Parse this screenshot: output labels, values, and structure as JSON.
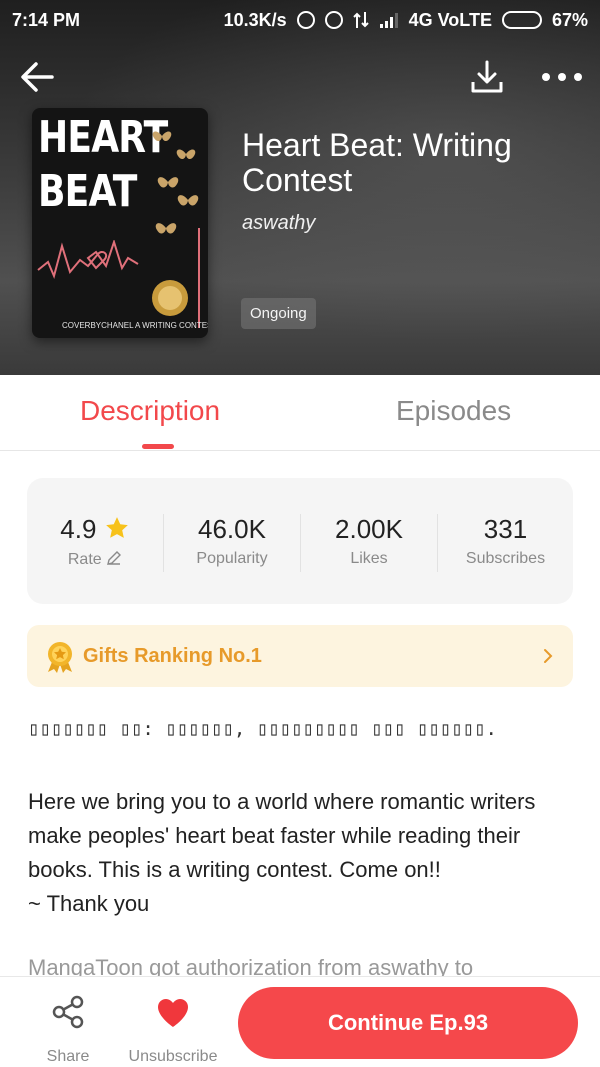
{
  "status_bar": {
    "time": "7:14 PM",
    "network_speed": "10.3K/s",
    "network": "4G VoLTE",
    "battery": "67%",
    "battery_level": 0.67
  },
  "topbar": {
    "back_icon": "arrow-left-icon",
    "download_icon": "download-icon",
    "more_icon": "more-dots-icon"
  },
  "book": {
    "cover": {
      "title_line1": "HEART",
      "title_line2": "BEAT",
      "footer": "COVERBYCHANEL  A WRITING CONTEST"
    },
    "title": "Heart Beat: Writing Contest",
    "author": "aswathy",
    "status": "Ongoing"
  },
  "tabs": [
    {
      "label": "Description",
      "active": true
    },
    {
      "label": "Episodes",
      "active": false
    }
  ],
  "stats": [
    {
      "value": "4.9",
      "label": "Rate"
    },
    {
      "value": "46.0K",
      "label": "Popularity"
    },
    {
      "value": "2.00K",
      "label": "Likes"
    },
    {
      "value": "331",
      "label": "Subscribes"
    }
  ],
  "gifts_ranking": {
    "label": "Gifts Ranking No.1"
  },
  "description": {
    "unsupported_line": "▯▯▯▯▯▯▯ ▯▯: ▯▯▯▯▯▯, ▯▯▯▯▯▯▯▯▯ ▯▯▯ ▯▯▯▯▯▯.",
    "body": "Here we bring you to a world where romantic writers make peoples' heart beat faster while reading their books. This is a writing contest. Come on!!",
    "sign_off": "~ Thank you",
    "faded_line": "MangaToon got authorization from aswathy to"
  },
  "bottom_bar": {
    "share_label": "Share",
    "unsubscribe_label": "Unsubscribe",
    "continue_label": "Continue Ep.93"
  },
  "colors": {
    "accent": "#f2484b",
    "gold": "#e79a2a",
    "gifts_bg": "#fdf4df"
  }
}
